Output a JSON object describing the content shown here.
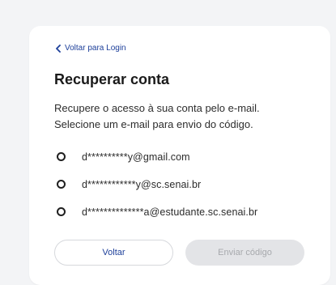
{
  "card": {
    "back_link_label": "Voltar para Login",
    "title": "Recuperar conta",
    "description_line1": "Recupere o acesso à sua conta pelo e-mail.",
    "description_line2": "Selecione um e-mail para envio do código.",
    "email_options": [
      "d**********y@gmail.com",
      "d************y@sc.senai.br",
      "d**************a@estudante.sc.senai.br"
    ],
    "back_button_label": "Voltar",
    "send_button_label": "Enviar código"
  },
  "colors": {
    "page_background": "#f3f4f6",
    "card_background": "#ffffff",
    "link_blue": "#1d3f9a",
    "disabled_button_bg": "#e3e4e7",
    "disabled_button_text": "#a7a9ad"
  },
  "icons": {
    "back_link": "chevron-left-icon",
    "option_selector": "radio-unchecked-icon"
  },
  "state": {
    "selected_option": null,
    "send_button_enabled": false
  }
}
